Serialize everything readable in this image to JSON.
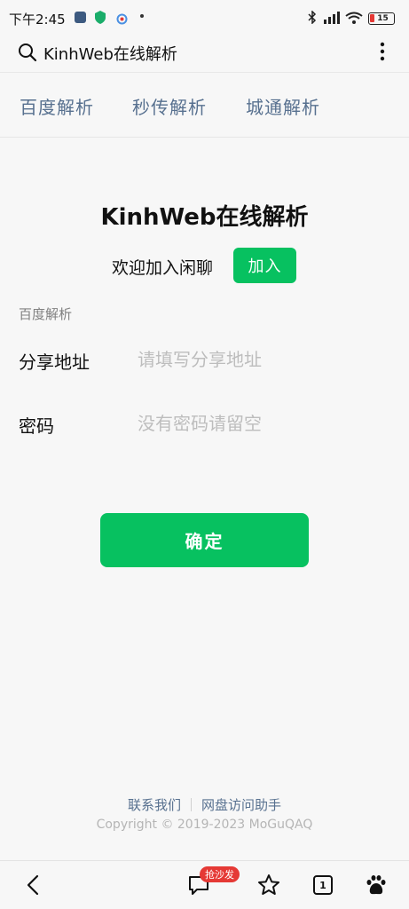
{
  "status_bar": {
    "time": "下午2:45",
    "battery": "15"
  },
  "browser": {
    "url_text": "KinhWeb在线解析"
  },
  "tabs": [
    {
      "label": "百度解析"
    },
    {
      "label": "秒传解析"
    },
    {
      "label": "城通解析"
    }
  ],
  "main": {
    "title": "KinhWeb在线解析",
    "welcome_text": "欢迎加入闲聊",
    "join_label": "加入",
    "section_label": "百度解析",
    "share_label": "分享地址",
    "share_placeholder": "请填写分享地址",
    "password_label": "密码",
    "password_placeholder": "没有密码请留空",
    "confirm_label": "确定"
  },
  "footer": {
    "contact_label": "联系我们",
    "helper_label": "网盘访问助手",
    "copyright": "Copyright © 2019-2023 MoGuQAQ"
  },
  "bottom_bar": {
    "badge": "抢沙发",
    "tab_count": "1"
  },
  "colors": {
    "accent": "#07c160",
    "link": "#57708f",
    "badge": "#e53935"
  }
}
